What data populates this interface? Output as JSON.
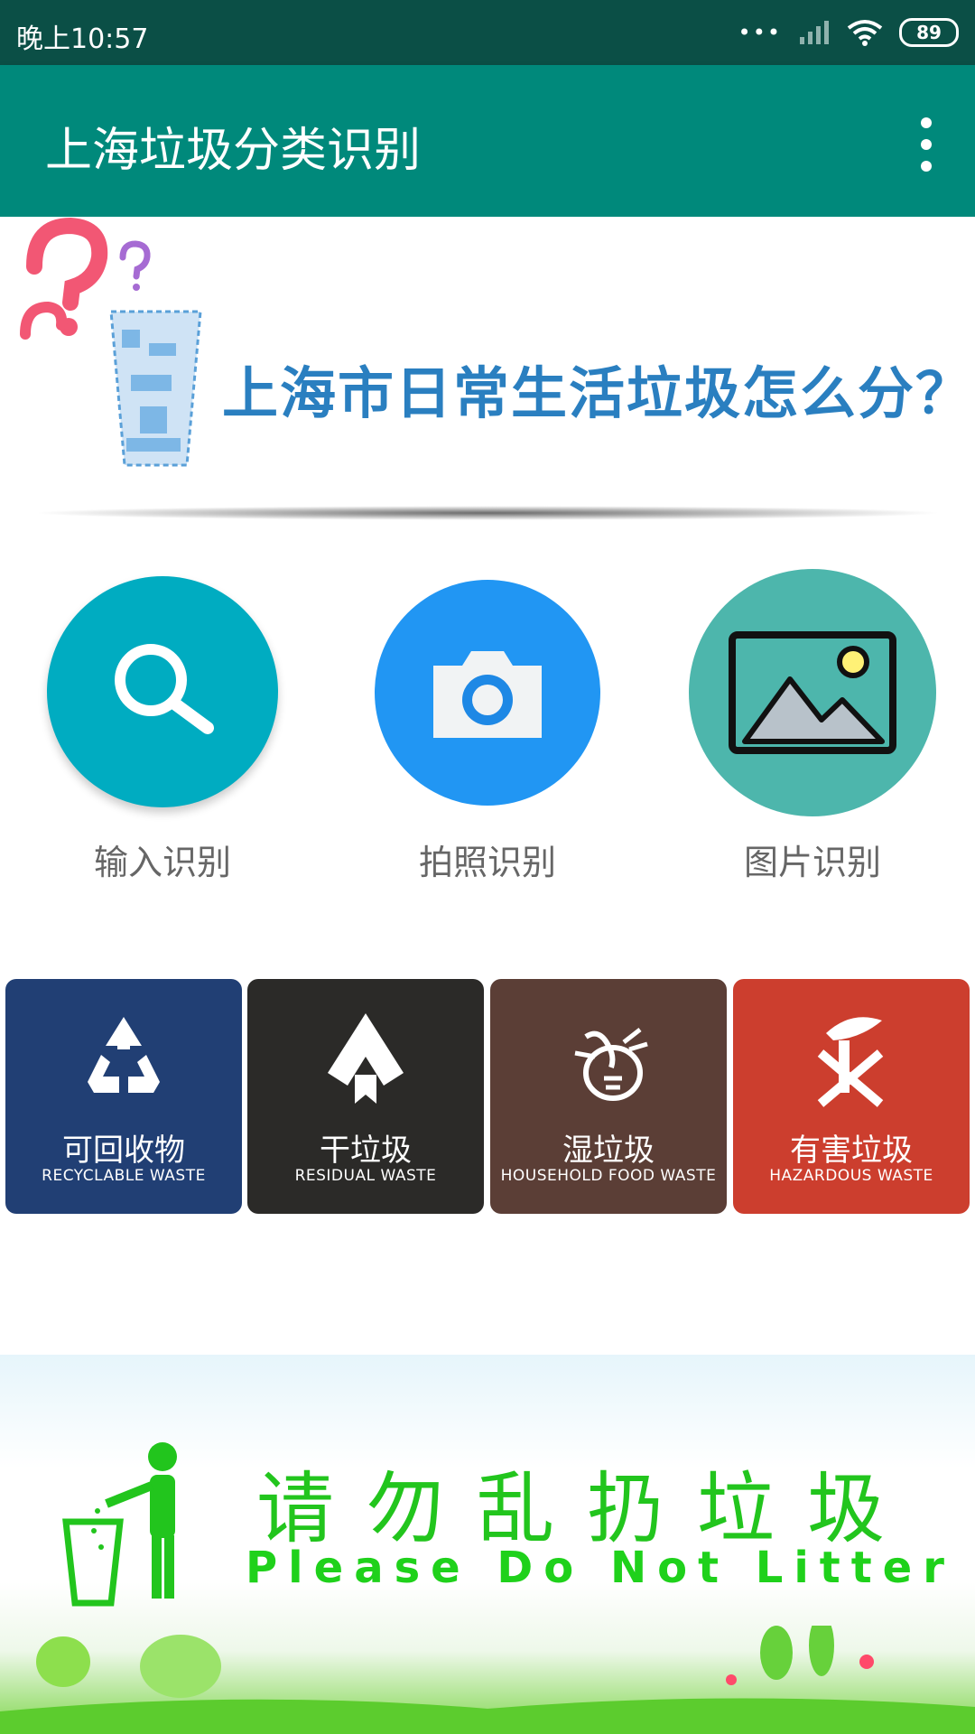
{
  "status_bar": {
    "time": "晚上10:57",
    "dots": "•••",
    "battery": "89"
  },
  "app_bar": {
    "title": "上海垃圾分类识别",
    "menu_icon": "more-vert-icon"
  },
  "top_banner": {
    "title": "上海市日常生活垃圾怎么分？"
  },
  "features": [
    {
      "label": "输入识别",
      "icon": "search-icon",
      "color": "#00acc1"
    },
    {
      "label": "拍照识别",
      "icon": "camera-icon",
      "color": "#2196f3"
    },
    {
      "label": "图片识别",
      "icon": "image-icon",
      "color": "#4db6ac"
    }
  ],
  "categories": [
    {
      "cn": "可回收物",
      "en": "RECYCLABLE WASTE",
      "color": "#213f74",
      "icon": "recycle-icon"
    },
    {
      "cn": "干垃圾",
      "en": "RESIDUAL WASTE",
      "color": "#2b2a28",
      "icon": "residual-waste-icon"
    },
    {
      "cn": "湿垃圾",
      "en": "HOUSEHOLD FOOD WASTE",
      "color": "#5b3e36",
      "icon": "food-waste-icon"
    },
    {
      "cn": "有害垃圾",
      "en": "HAZARDOUS WASTE",
      "color": "#cc3e2e",
      "icon": "hazardous-waste-icon"
    }
  ],
  "bottom_banner": {
    "cn": "请勿乱扔垃圾",
    "en": "Please Do Not Litter"
  }
}
